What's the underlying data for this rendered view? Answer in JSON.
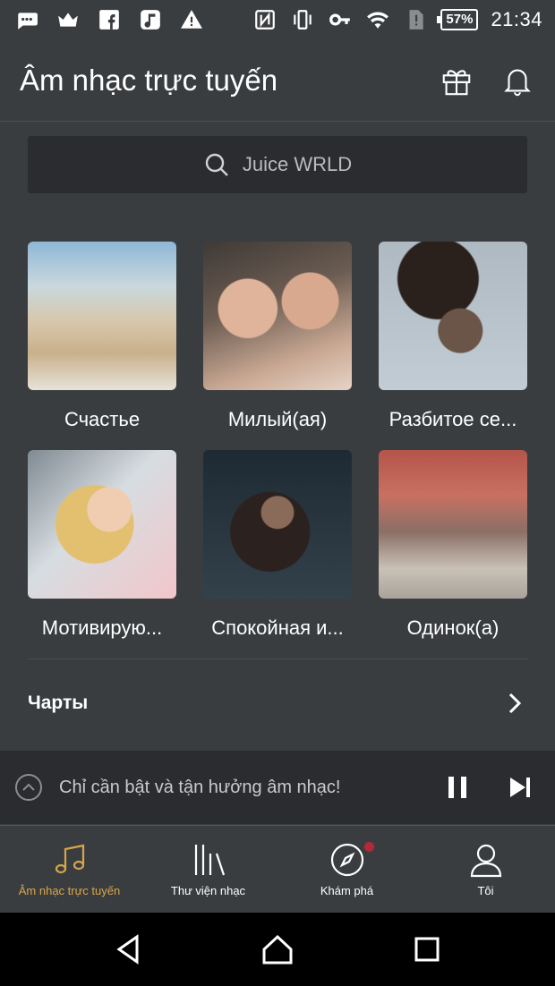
{
  "status_bar": {
    "battery": "57%",
    "time": "21:34",
    "icons": [
      "message-icon",
      "crown-icon",
      "facebook-icon",
      "music-note-icon",
      "warning-icon",
      "nfc-icon",
      "vibrate-icon",
      "key-icon",
      "wifi-icon",
      "sim-alert-icon"
    ]
  },
  "header": {
    "title": "Âm nhạc trực tuyến",
    "actions": [
      "gift-icon",
      "bell-icon"
    ]
  },
  "search": {
    "placeholder": "Juice WRLD"
  },
  "moods": [
    {
      "label": "Счастье"
    },
    {
      "label": "Милый(ая)"
    },
    {
      "label": "Разбитое се..."
    },
    {
      "label": "Мотивирую..."
    },
    {
      "label": "Спокойная и..."
    },
    {
      "label": "Одинок(а)"
    }
  ],
  "charts": {
    "label": "Чарты"
  },
  "mini_player": {
    "text": "Chỉ cần bật và tận hưởng âm nhạc!"
  },
  "bottom_nav": [
    {
      "label": "Âm nhạc trực tuyến",
      "icon": "music-notes-icon",
      "active": true
    },
    {
      "label": "Thư viện nhạc",
      "icon": "library-icon",
      "active": false
    },
    {
      "label": "Khám phá",
      "icon": "compass-icon",
      "active": false,
      "badge": true
    },
    {
      "label": "Tôi",
      "icon": "user-icon",
      "active": false
    }
  ],
  "colors": {
    "background": "#3a3d40",
    "surface_dark": "#2a2c2f",
    "accent": "#d7a64a",
    "badge": "#b5283a"
  }
}
